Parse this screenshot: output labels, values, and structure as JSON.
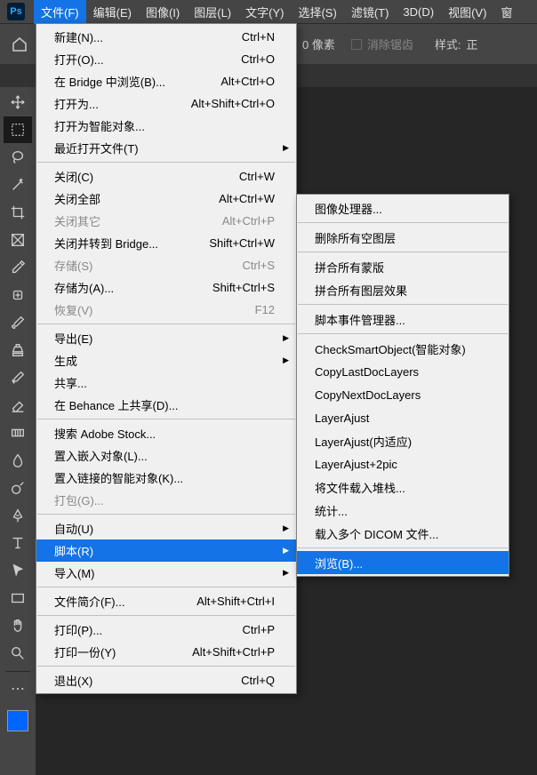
{
  "app_abbrev": "Ps",
  "menubar": {
    "file": "文件(F)",
    "edit": "编辑(E)",
    "image": "图像(I)",
    "layer": "图层(L)",
    "type": "文字(Y)",
    "select": "选择(S)",
    "filter": "滤镜(T)",
    "threed": "3D(D)",
    "view": "视图(V)",
    "window": "窗"
  },
  "optbar": {
    "px_label": "0 像素",
    "antialias": "消除锯齿",
    "style": "样式:",
    "normal": "正"
  },
  "file_menu": [
    {
      "label": "新建(N)...",
      "sc": "Ctrl+N"
    },
    {
      "label": "打开(O)...",
      "sc": "Ctrl+O"
    },
    {
      "label": "在 Bridge 中浏览(B)...",
      "sc": "Alt+Ctrl+O"
    },
    {
      "label": "打开为...",
      "sc": "Alt+Shift+Ctrl+O"
    },
    {
      "label": "打开为智能对象...",
      "sc": ""
    },
    {
      "label": "最近打开文件(T)",
      "sc": "",
      "sub": true
    },
    {
      "sep": true
    },
    {
      "label": "关闭(C)",
      "sc": "Ctrl+W"
    },
    {
      "label": "关闭全部",
      "sc": "Alt+Ctrl+W"
    },
    {
      "label": "关闭其它",
      "sc": "Alt+Ctrl+P",
      "disabled": true
    },
    {
      "label": "关闭并转到 Bridge...",
      "sc": "Shift+Ctrl+W"
    },
    {
      "label": "存储(S)",
      "sc": "Ctrl+S",
      "disabled": true
    },
    {
      "label": "存储为(A)...",
      "sc": "Shift+Ctrl+S"
    },
    {
      "label": "恢复(V)",
      "sc": "F12",
      "disabled": true
    },
    {
      "sep": true
    },
    {
      "label": "导出(E)",
      "sc": "",
      "sub": true
    },
    {
      "label": "生成",
      "sc": "",
      "sub": true
    },
    {
      "label": "共享...",
      "sc": ""
    },
    {
      "label": "在 Behance 上共享(D)...",
      "sc": ""
    },
    {
      "sep": true
    },
    {
      "label": "搜索 Adobe Stock...",
      "sc": ""
    },
    {
      "label": "置入嵌入对象(L)...",
      "sc": ""
    },
    {
      "label": "置入链接的智能对象(K)...",
      "sc": ""
    },
    {
      "label": "打包(G)...",
      "sc": "",
      "disabled": true
    },
    {
      "sep": true
    },
    {
      "label": "自动(U)",
      "sc": "",
      "sub": true
    },
    {
      "label": "脚本(R)",
      "sc": "",
      "sub": true,
      "highlight": true
    },
    {
      "label": "导入(M)",
      "sc": "",
      "sub": true
    },
    {
      "sep": true
    },
    {
      "label": "文件简介(F)...",
      "sc": "Alt+Shift+Ctrl+I"
    },
    {
      "sep": true
    },
    {
      "label": "打印(P)...",
      "sc": "Ctrl+P"
    },
    {
      "label": "打印一份(Y)",
      "sc": "Alt+Shift+Ctrl+P"
    },
    {
      "sep": true
    },
    {
      "label": "退出(X)",
      "sc": "Ctrl+Q"
    }
  ],
  "script_menu": [
    {
      "label": "图像处理器...",
      "sc": ""
    },
    {
      "sep": true
    },
    {
      "label": "删除所有空图层",
      "sc": ""
    },
    {
      "sep": true
    },
    {
      "label": "拼合所有蒙版",
      "sc": ""
    },
    {
      "label": "拼合所有图层效果",
      "sc": ""
    },
    {
      "sep": true
    },
    {
      "label": "脚本事件管理器...",
      "sc": ""
    },
    {
      "sep": true
    },
    {
      "label": "CheckSmartObject(智能对象)",
      "sc": ""
    },
    {
      "label": "CopyLastDocLayers",
      "sc": ""
    },
    {
      "label": "CopyNextDocLayers",
      "sc": ""
    },
    {
      "label": "LayerAjust",
      "sc": ""
    },
    {
      "label": "LayerAjust(内适应)",
      "sc": ""
    },
    {
      "label": "LayerAjust+2pic",
      "sc": ""
    },
    {
      "label": "将文件载入堆栈...",
      "sc": ""
    },
    {
      "label": "统计...",
      "sc": ""
    },
    {
      "label": "载入多个 DICOM 文件...",
      "sc": ""
    },
    {
      "sep": true
    },
    {
      "label": "浏览(B)...",
      "sc": "",
      "highlight": true
    }
  ]
}
